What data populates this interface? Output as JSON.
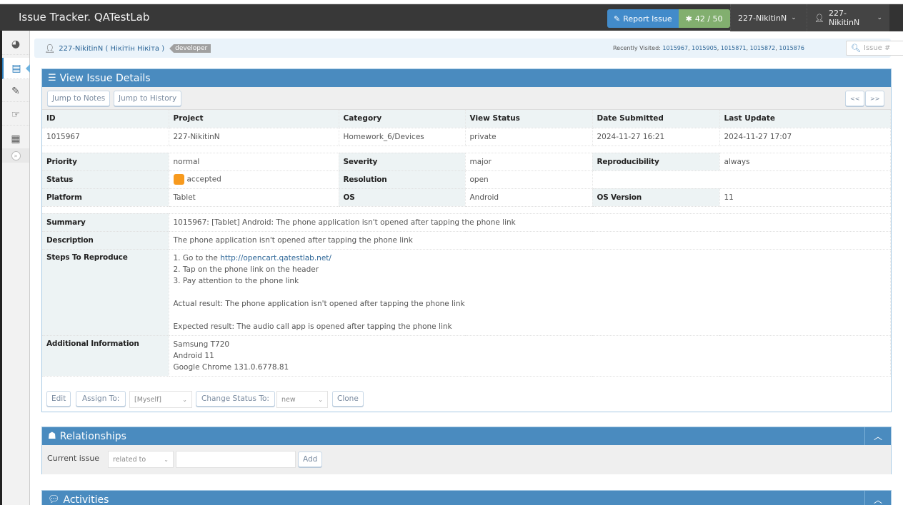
{
  "app": {
    "title": "Issue Tracker. QATestLab",
    "report_issue_label": "Report Issue",
    "issue_count": "42 / 50",
    "project_dropdown": "227-NikitinN",
    "user_dropdown": "227-NikitinN"
  },
  "sidebar": {
    "items": [
      {
        "name": "dashboard",
        "icon": "tachometer-icon",
        "glyph": "◕"
      },
      {
        "name": "view-issues",
        "icon": "list-icon",
        "glyph": "▤",
        "active": true
      },
      {
        "name": "report-issue",
        "icon": "edit-icon",
        "glyph": "✎"
      },
      {
        "name": "change-log",
        "icon": "hand-pointer-icon",
        "glyph": "☞"
      },
      {
        "name": "roadmap",
        "icon": "board-icon",
        "glyph": "▦"
      }
    ],
    "collapse_glyph": "»"
  },
  "breadcrumbs": {
    "user": "227-NikitinN ( Нікітін Нікіта )",
    "role": "developer",
    "recently_visited_label": "Recently Visited:",
    "recently_visited": [
      "1015967",
      "1015905",
      "1015871",
      "1015872",
      "1015876"
    ],
    "search_placeholder": "Issue #"
  },
  "details": {
    "title": "View Issue Details",
    "jump_notes": "Jump to Notes",
    "jump_history": "Jump to History",
    "prev": "<<",
    "next": ">>",
    "headers": [
      "ID",
      "Project",
      "Category",
      "View Status",
      "Date Submitted",
      "Last Update"
    ],
    "values": [
      "1015967",
      "227-NikitinN",
      "Homework_6/Devices",
      "private",
      "2024-11-27 16:21",
      "2024-11-27 17:07"
    ],
    "priority_label": "Priority",
    "priority": "normal",
    "severity_label": "Severity",
    "severity": "major",
    "reproducibility_label": "Reproducibility",
    "reproducibility": "always",
    "status_label": "Status",
    "status": "accepted",
    "status_color": "#f79a1e",
    "resolution_label": "Resolution",
    "resolution": "open",
    "platform_label": "Platform",
    "platform": "Tablet",
    "os_label": "OS",
    "os": "Android",
    "os_version_label": "OS Version",
    "os_version": "11",
    "summary_label": "Summary",
    "summary": "1015967: [Tablet] Android: The phone application isn't opened after tapping the phone link",
    "description_label": "Description",
    "description": "The phone application isn't opened after tapping the phone link",
    "steps_label": "Steps To Reproduce",
    "steps": {
      "step1_prefix": "1. Go to the ",
      "step1_link": "http://opencart.qatestlab.net/",
      "step2": "2. Tap on the phone link on the header",
      "step3": "3. Pay attention to the phone link",
      "actual": "Actual result: The phone application isn't opened after tapping the phone link",
      "expected": "Expected result: The audio call app is opened after tapping the phone link"
    },
    "additional_label": "Additional Information",
    "additional": [
      "Samsung T720",
      "Android 11",
      "Google Chrome 131.0.6778.81"
    ],
    "actions": {
      "edit": "Edit",
      "assign_to": "Assign To:",
      "assign_value": "[Myself]",
      "change_status": "Change Status To:",
      "status_value": "new",
      "clone": "Clone"
    }
  },
  "relationships": {
    "title": "Relationships",
    "current_issue_label": "Current issue",
    "relation_value": "related to",
    "issue_input_value": "",
    "add_label": "Add"
  },
  "activities": {
    "title": "Activities"
  }
}
